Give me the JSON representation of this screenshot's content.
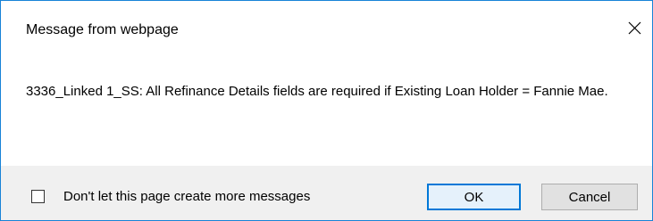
{
  "dialog": {
    "title": "Message from webpage",
    "close_icon": "close-icon",
    "message": "3336_Linked 1_SS: All Refinance Details fields are required if Existing Loan Holder = Fannie Mae.",
    "checkbox_label": "Don't let this page create more messages",
    "checkbox_checked": false,
    "ok_label": "OK",
    "cancel_label": "Cancel"
  },
  "colors": {
    "border": "#1883d7",
    "footer_bg": "#f0f0f0",
    "default_button_border": "#0078d7"
  }
}
